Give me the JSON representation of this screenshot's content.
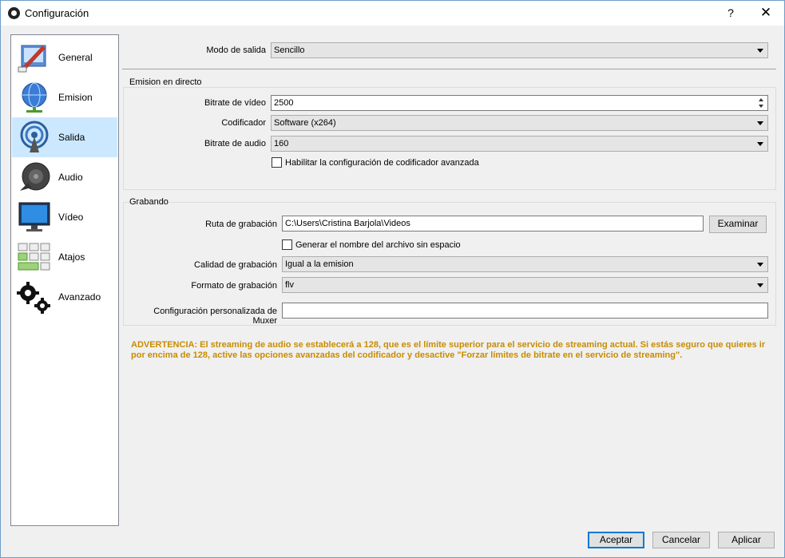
{
  "window": {
    "title": "Configuración",
    "help": "?",
    "close": "✕"
  },
  "sidebar": {
    "items": [
      {
        "label": "General",
        "icon": "general-icon"
      },
      {
        "label": "Emision",
        "icon": "globe-icon"
      },
      {
        "label": "Salida",
        "icon": "broadcast-icon",
        "active": true
      },
      {
        "label": "Audio",
        "icon": "speaker-icon"
      },
      {
        "label": "Vídeo",
        "icon": "monitor-icon"
      },
      {
        "label": "Atajos",
        "icon": "keyboard-icon"
      },
      {
        "label": "Avanzado",
        "icon": "gears-icon"
      }
    ]
  },
  "output_mode": {
    "label": "Modo de salida",
    "value": "Sencillo"
  },
  "streaming": {
    "title": "Emision en directo",
    "video_bitrate": {
      "label": "Bitrate de vídeo",
      "value": "2500"
    },
    "encoder": {
      "label": "Codificador",
      "value": "Software (x264)"
    },
    "audio_bitrate": {
      "label": "Bitrate de audio",
      "value": "160"
    },
    "advanced": {
      "label": "Habilitar la configuración de codificador avanzada",
      "checked": false
    }
  },
  "recording": {
    "title": "Grabando",
    "path": {
      "label": "Ruta de grabación",
      "value": "C:\\Users\\Cristina Barjola\\Videos",
      "browse": "Examinar"
    },
    "nospace": {
      "label": "Generar el nombre del archivo sin espacio",
      "checked": false
    },
    "quality": {
      "label": "Calidad de grabación",
      "value": "Igual a la emision"
    },
    "format": {
      "label": "Formato de grabación",
      "value": "flv"
    },
    "muxer": {
      "label": "Configuración personalizada de Muxer",
      "value": ""
    }
  },
  "warning": "ADVERTENCIA: El streaming de audio se establecerá a 128, que es el límite superior para el servicio de streaming actual.  Si estás seguro que quieres ir por encima de 128, active las opciones avanzadas del codificador y desactive \"Forzar límites de bitrate en el servicio de streaming\".",
  "buttons": {
    "accept": "Aceptar",
    "cancel": "Cancelar",
    "apply": "Aplicar"
  },
  "colors": {
    "warning": "#c98c00",
    "active_item": "#cce8ff",
    "default_button_border": "#0078d7"
  }
}
